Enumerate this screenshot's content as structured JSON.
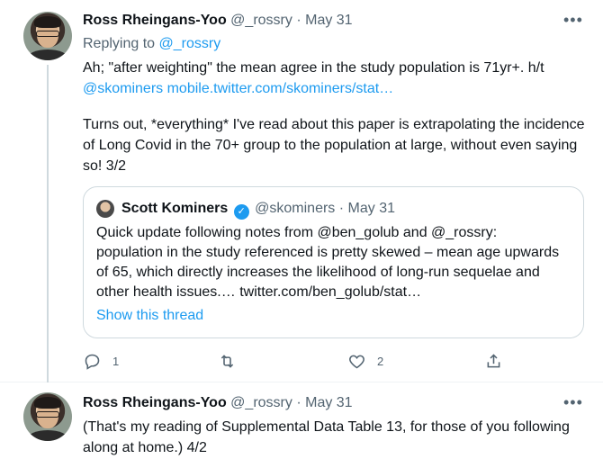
{
  "tweets": [
    {
      "author_name": "Ross Rheingans-Yoo",
      "handle": "@_rossry",
      "separator": "·",
      "date": "May 31",
      "more_icon": "more-horizontal-icon",
      "replying_prefix": "Replying to",
      "replying_handle": "@_rossry",
      "text_line1": "Ah; \"after weighting\" the mean agree in the study population is 71yr+. h/t",
      "text_line1_link": "@skominers mobile.twitter.com/skominers/stat…",
      "text_para2": "Turns out, *everything* I've read about this paper is extrapolating the incidence of Long Covid in the 70+ group to the population at large, without even saying so! 3/2",
      "quote": {
        "author_name": "Scott Kominers",
        "handle": "@skominers",
        "separator": "·",
        "date": "May 31",
        "verified_icon": "verified-badge-icon",
        "text": "Quick update following notes from @ben_golub and @_rossry: population in the study referenced is pretty skewed – mean age upwards of 65, which directly increases the likelihood of long-run sequelae and other health issues.… twitter.com/ben_golub/stat…",
        "show_thread": "Show this thread"
      },
      "actions": {
        "reply_count": "1",
        "retweet_count": "",
        "like_count": "2",
        "icons": [
          "reply-icon",
          "retweet-icon",
          "like-icon",
          "share-icon"
        ]
      }
    },
    {
      "author_name": "Ross Rheingans-Yoo",
      "handle": "@_rossry",
      "separator": "·",
      "date": "May 31",
      "more_icon": "more-horizontal-icon",
      "text": "(That's my reading of Supplemental Data Table 13, for those of you following along at home.) 4/2"
    }
  ],
  "colors": {
    "link": "#1d9bf0",
    "secondary_text": "#536471",
    "border": "#cfd9de"
  }
}
